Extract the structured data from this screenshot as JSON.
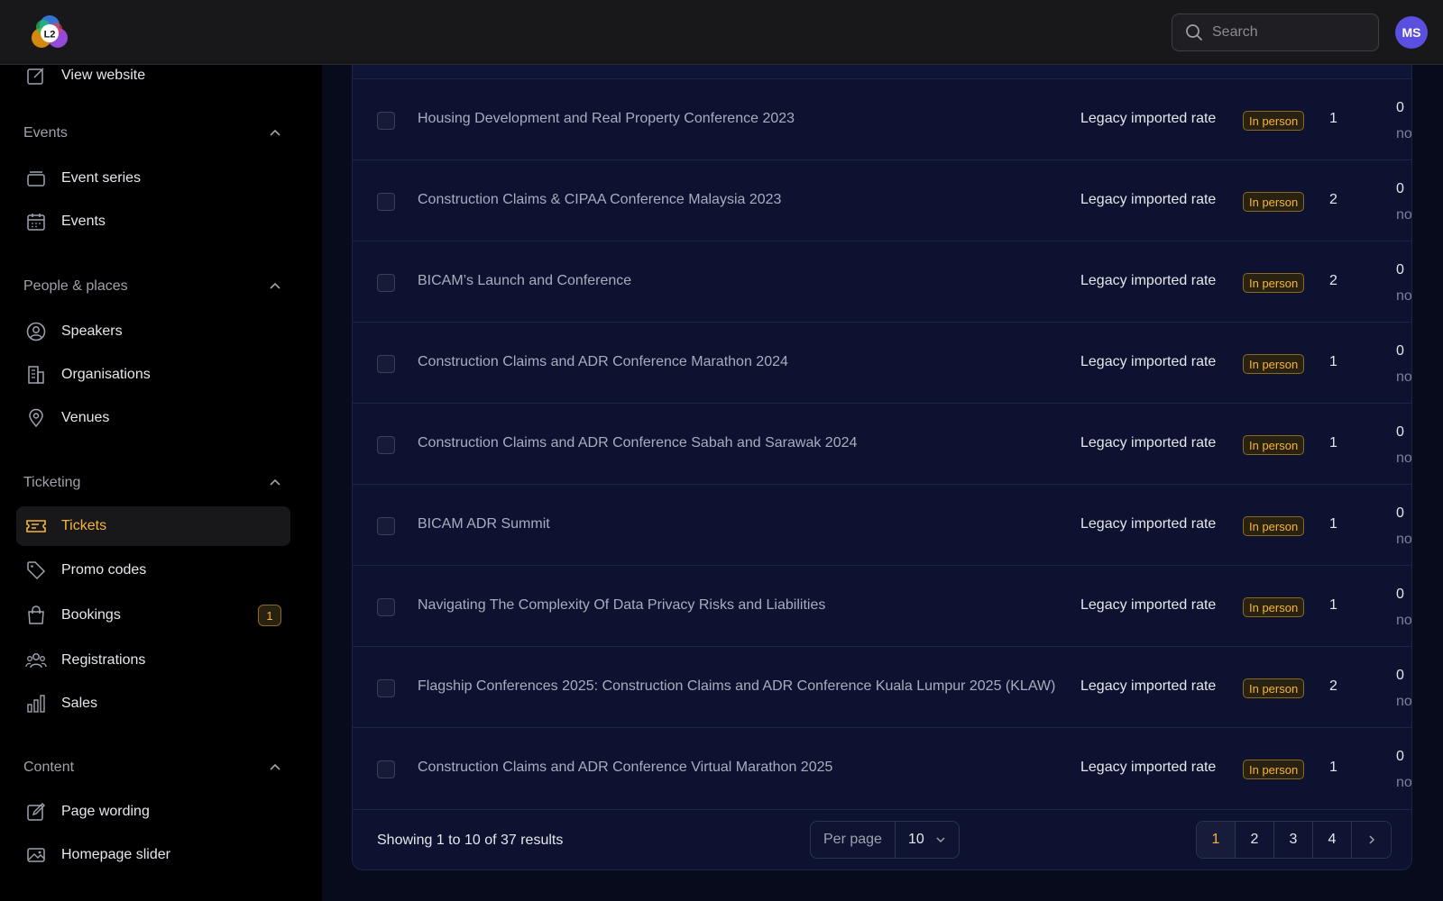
{
  "header": {
    "logo_text": "L2",
    "search_placeholder": "Search",
    "avatar_initials": "MS"
  },
  "sidebar": {
    "view_website": "View website",
    "sections": {
      "events": {
        "title": "Events",
        "items": [
          "Event series",
          "Events"
        ]
      },
      "people": {
        "title": "People & places",
        "items": [
          "Speakers",
          "Organisations",
          "Venues"
        ]
      },
      "ticketing": {
        "title": "Ticketing",
        "items": [
          "Tickets",
          "Promo codes",
          "Bookings",
          "Registrations",
          "Sales"
        ],
        "bookings_badge": "1",
        "active": "Tickets"
      },
      "content": {
        "title": "Content",
        "items": [
          "Page wording",
          "Homepage slider"
        ]
      }
    }
  },
  "table": {
    "rows": [
      {
        "name": "Housing Development and Real Property Conference 2023",
        "rate": "Legacy imported rate",
        "mode": "In person",
        "qty": "1",
        "sold": "0",
        "sub": "no"
      },
      {
        "name": "Construction Claims & CIPAA Conference Malaysia 2023",
        "rate": "Legacy imported rate",
        "mode": "In person",
        "qty": "2",
        "sold": "0",
        "sub": "no"
      },
      {
        "name": "BICAM’s Launch and Conference",
        "rate": "Legacy imported rate",
        "mode": "In person",
        "qty": "2",
        "sold": "0",
        "sub": "no"
      },
      {
        "name": "Construction Claims and ADR Conference Marathon 2024",
        "rate": "Legacy imported rate",
        "mode": "In person",
        "qty": "1",
        "sold": "0",
        "sub": "no"
      },
      {
        "name": "Construction Claims and ADR Conference Sabah and Sarawak 2024",
        "rate": "Legacy imported rate",
        "mode": "In person",
        "qty": "1",
        "sold": "0",
        "sub": "no"
      },
      {
        "name": "BICAM ADR Summit",
        "rate": "Legacy imported rate",
        "mode": "In person",
        "qty": "1",
        "sold": "0",
        "sub": "no"
      },
      {
        "name": "Navigating The Complexity Of Data Privacy Risks and Liabilities",
        "rate": "Legacy imported rate",
        "mode": "In person",
        "qty": "1",
        "sold": "0",
        "sub": "no"
      },
      {
        "name": "Flagship Conferences 2025: Construction Claims and ADR Conference Kuala Lumpur 2025 (KLAW)",
        "rate": "Legacy imported rate",
        "mode": "In person",
        "qty": "2",
        "sold": "0",
        "sub": "no"
      },
      {
        "name": "Construction Claims and ADR Conference Virtual Marathon 2025",
        "rate": "Legacy imported rate",
        "mode": "In person",
        "qty": "1",
        "sold": "0",
        "sub": "no"
      }
    ]
  },
  "footer": {
    "showing": "Showing 1 to 10 of 37 results",
    "per_page_label": "Per page",
    "per_page_value": "10",
    "pages": [
      "1",
      "2",
      "3",
      "4"
    ],
    "current_page": "1"
  },
  "colors": {
    "accent": "#f5b43c",
    "panel_bg": "#0c1230",
    "sidebar_bg": "#000000",
    "topbar_bg": "#18181b",
    "avatar_bg": "#5b4fe0"
  }
}
